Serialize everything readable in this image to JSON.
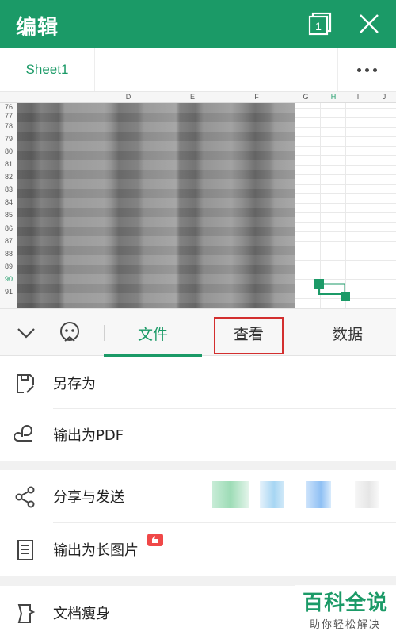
{
  "header": {
    "title": "编辑",
    "window_count": "1"
  },
  "sheet": {
    "tab_name": "Sheet1"
  },
  "grid": {
    "columns": [
      {
        "label": "D"
      },
      {
        "label": "E"
      },
      {
        "label": "F"
      },
      {
        "label": "G"
      },
      {
        "label": "H",
        "active": true
      },
      {
        "label": "I"
      },
      {
        "label": "J"
      }
    ],
    "rows": [
      "76",
      "77",
      "78",
      "79",
      "80",
      "81",
      "82",
      "83",
      "84",
      "85",
      "86",
      "87",
      "88",
      "89",
      "90",
      "91"
    ],
    "active_row": "90"
  },
  "toolbar": {
    "tabs": [
      {
        "label": "文件",
        "active": true
      },
      {
        "label": "查看",
        "highlighted": true
      },
      {
        "label": "数据"
      }
    ]
  },
  "menu": {
    "save_as": "另存为",
    "export_pdf": "输出为PDF",
    "share_send": "分享与发送",
    "export_long_image": "输出为长图片",
    "slim_document": "文档瘦身"
  },
  "watermark": {
    "title": "百科全说",
    "subtitle": "助你轻松解决"
  },
  "colors": {
    "brand": "#1b9a67",
    "highlight": "#d32f2f",
    "badge": "#f04848"
  }
}
